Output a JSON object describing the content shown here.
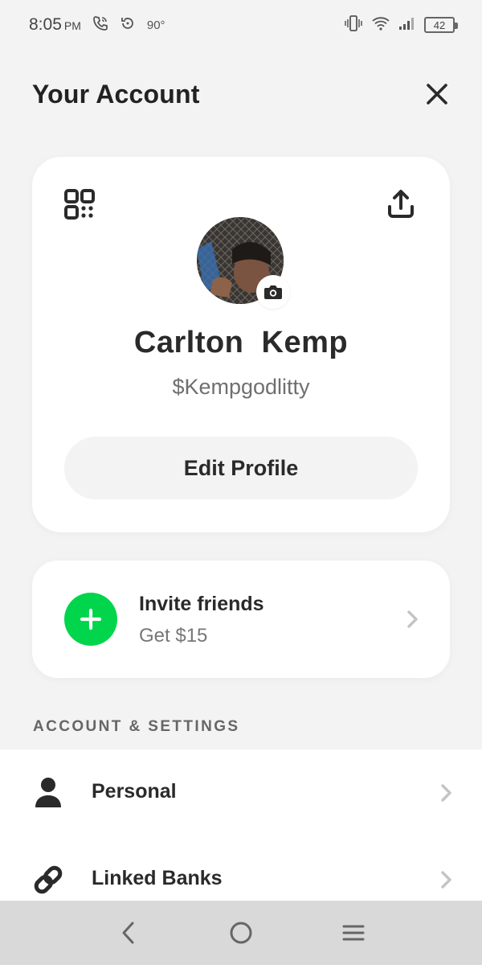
{
  "status_bar": {
    "time": "8:05",
    "ampm": "PM",
    "temperature": "90°",
    "battery": "42"
  },
  "header": {
    "title": "Your Account",
    "close_icon": "close-icon"
  },
  "profile": {
    "name": "Carlton  Kemp",
    "cashtag": "$Kempgodlitty",
    "edit_label": "Edit Profile",
    "qr_icon": "qr-code-icon",
    "share_icon": "share-icon",
    "camera_icon": "camera-icon"
  },
  "invite": {
    "title": "Invite friends",
    "subtitle": "Get $15",
    "accent": "#00d54b"
  },
  "settings": {
    "section_label": "ACCOUNT & SETTINGS",
    "items": [
      {
        "label": "Personal",
        "icon": "person-icon"
      },
      {
        "label": "Linked Banks",
        "icon": "link-icon"
      }
    ]
  },
  "nav": {
    "back_icon": "back-icon",
    "home_icon": "home-icon",
    "menu_icon": "menu-icon"
  }
}
